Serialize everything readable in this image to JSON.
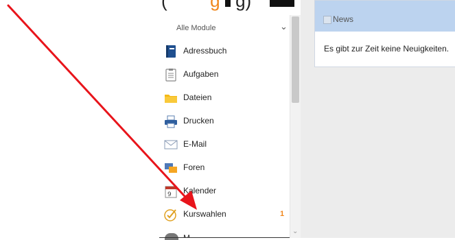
{
  "caption": {
    "open_paren": "(",
    "orange_text": "g",
    "plain_text": "g)"
  },
  "sidebar": {
    "header_label": "Alle Module",
    "items": [
      {
        "label": "Adressbuch",
        "icon": "address-book-icon",
        "badge": ""
      },
      {
        "label": "Aufgaben",
        "icon": "clipboard-icon",
        "badge": ""
      },
      {
        "label": "Dateien",
        "icon": "folder-icon",
        "badge": ""
      },
      {
        "label": "Drucken",
        "icon": "printer-icon",
        "badge": ""
      },
      {
        "label": "E-Mail",
        "icon": "mail-icon",
        "badge": ""
      },
      {
        "label": "Foren",
        "icon": "forum-icon",
        "badge": ""
      },
      {
        "label": "Kalender",
        "icon": "calendar-icon",
        "badge": ""
      },
      {
        "label": "Kurswahlen",
        "icon": "check-circle-icon",
        "badge": "1"
      }
    ],
    "partial_item_label": "M"
  },
  "news": {
    "title": "News",
    "empty_message": "Es gibt zur Zeit keine Neuigkeiten."
  },
  "colors": {
    "accent_orange": "#f0861a",
    "news_header_blue": "#bcd3ef",
    "arrow_red": "#e8141b"
  }
}
